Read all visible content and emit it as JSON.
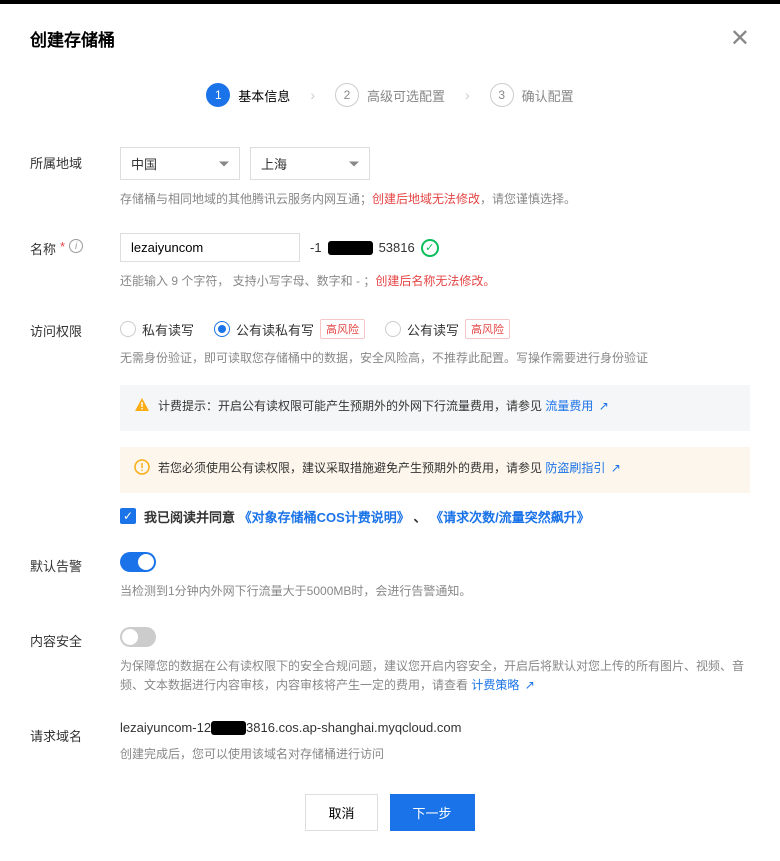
{
  "title": "创建存储桶",
  "steps": [
    {
      "num": "1",
      "label": "基本信息"
    },
    {
      "num": "2",
      "label": "高级可选配置"
    },
    {
      "num": "3",
      "label": "确认配置"
    }
  ],
  "region": {
    "label": "所属地域",
    "country": "中国",
    "city": "上海",
    "hint_pre": "存储桶与相同地域的其他腾讯云服务内网互通；",
    "hint_red": "创建后地域无法修改",
    "hint_post": "，请您谨慎选择。"
  },
  "name": {
    "label": "名称",
    "value": "lezaiyuncom",
    "suffix_pre": "-1",
    "suffix_post": "53816",
    "hint_pre": "还能输入 9 个字符， 支持小写字母、数字和 - ；",
    "hint_red": "创建后名称无法修改。"
  },
  "access": {
    "label": "访问权限",
    "option_private": "私有读写",
    "option_public_read": "公有读私有写",
    "option_public_rw": "公有读写",
    "risk_label": "高风险",
    "hint": "无需身份验证，即可读取您存储桶中的数据，安全风险高，不推荐此配置。写操作需要进行身份验证",
    "billing_notice": "计费提示：开启公有读权限可能产生预期外的外网下行流量费用，请参见",
    "billing_link": "流量费用",
    "steal_notice": "若您必须使用公有读权限，建议采取措施避免产生预期外的费用，请参见",
    "steal_link": "防盗刷指引",
    "agree_pre": "我已阅读并同意",
    "agree_link1": "《对象存储桶COS计费说明》",
    "agree_sep": "、",
    "agree_link2": "《请求次数/流量突然飙升》"
  },
  "alarm": {
    "label": "默认告警",
    "hint": "当检测到1分钟内外网下行流量大于5000MB时，会进行告警通知。"
  },
  "security": {
    "label": "内容安全",
    "hint": "为保障您的数据在公有读权限下的安全合规问题，建议您开启内容安全，开启后将默认对您上传的所有图片、视频、音频、文本数据进行内容审核，内容审核将产生一定的费用，请查看",
    "link": "计费策略"
  },
  "domain": {
    "label": "请求域名",
    "value_pre": "lezaiyuncom-12",
    "value_post": "3816.cos.ap-shanghai.myqcloud.com",
    "hint": "创建完成后，您可以使用该域名对存储桶进行访问"
  },
  "footer": {
    "cancel": "取消",
    "next": "下一步"
  }
}
